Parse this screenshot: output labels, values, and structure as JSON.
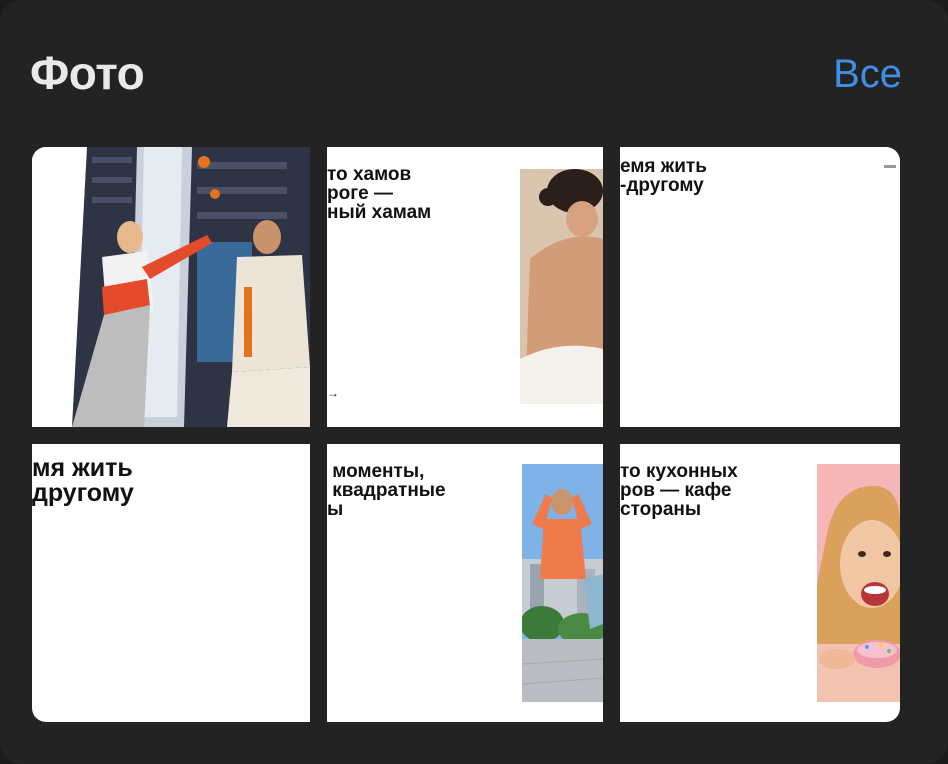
{
  "header": {
    "title": "Фото",
    "see_all": "Все"
  },
  "tiles": [
    {
      "caption": ""
    },
    {
      "caption": "то хамов\nроге —\nный хамам",
      "small_note": "→"
    },
    {
      "caption": "емя жить\n-другому"
    },
    {
      "caption": "мя жить\nдругому"
    },
    {
      "caption": " моменты,\n квадратные\nы"
    },
    {
      "caption": "то кухонных\nров — кафе\nсторaны"
    }
  ],
  "colors": {
    "accent": "#3f8ee8",
    "background": "#232323",
    "title": "#e9e9e9"
  }
}
